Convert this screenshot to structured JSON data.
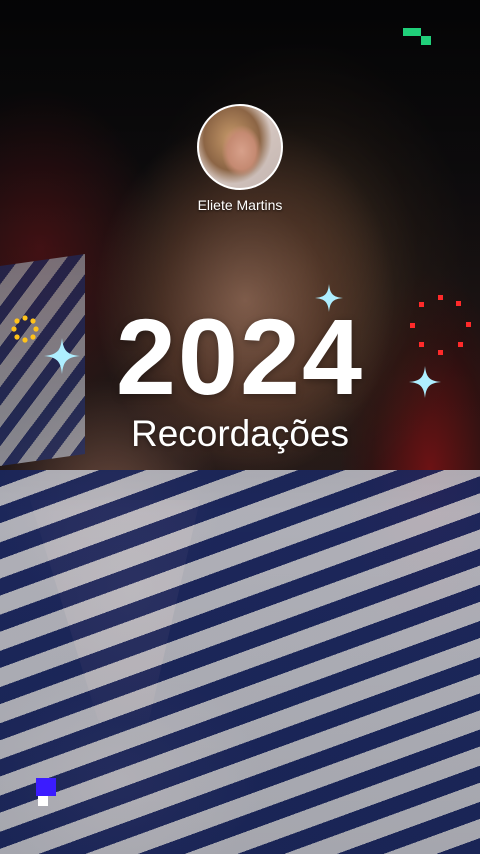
{
  "story": {
    "username": "Eliete Martins",
    "year": "2024",
    "subtitle": "Recordações"
  },
  "decorations": {
    "sparkle_icon": "four-point-star-icon",
    "ring_icon": "dotted-ring-icon",
    "square_icon": "pixel-square-icon",
    "colors": {
      "sparkle": "#9fe8ff",
      "green": "#20d07a",
      "red": "#ff2a2a",
      "yellow": "#ffc21a",
      "blue": "#3b1cff"
    }
  }
}
